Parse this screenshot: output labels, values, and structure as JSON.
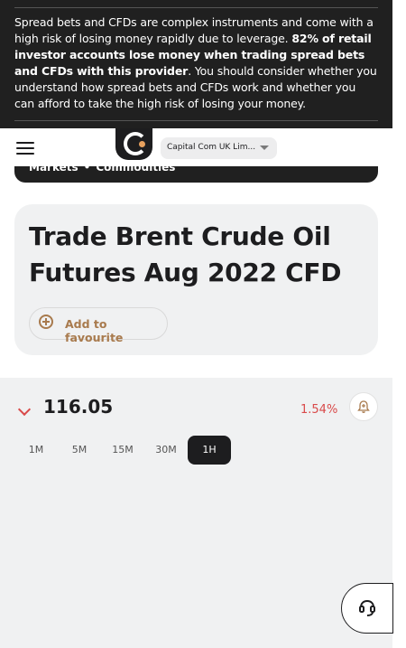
{
  "risk_warning": {
    "text_part1": "Spread bets and CFDs are complex instruments and come with a high risk of losing money rapidly due to leverage. ",
    "text_bold": "82% of retail investor accounts lose money when trading spread bets and CFDs with this provider",
    "text_part2": ". You should consider whether you understand how spread bets and CFDs work and whether you can afford to take the high risk of losing your money."
  },
  "header": {
    "menu_icon": "hamburger-icon",
    "logo_icon": "capital-com-logo",
    "entity_select_value": "Capital Com UK Lim..."
  },
  "breadcrumb": {
    "items": [
      "Markets",
      "Commodities"
    ],
    "separator": "•"
  },
  "instrument": {
    "title": "Trade Brent Crude Oil Futures Aug 2022 CFD",
    "favourite_label": "Add to favourite"
  },
  "quote": {
    "price": "116.05",
    "change": "1.54%",
    "direction_icon": "chevron-down-icon",
    "alert_icon": "bell-plus-icon"
  },
  "timeframes": {
    "items": [
      "1M",
      "5M",
      "15M",
      "30M",
      "1H"
    ],
    "selected": "1H"
  },
  "support": {
    "icon": "headset-icon"
  },
  "colors": {
    "banner_bg": "#202020",
    "accent": "#a87a4d",
    "negative": "#d94a4a",
    "card_bg": "#f0f1f2"
  }
}
